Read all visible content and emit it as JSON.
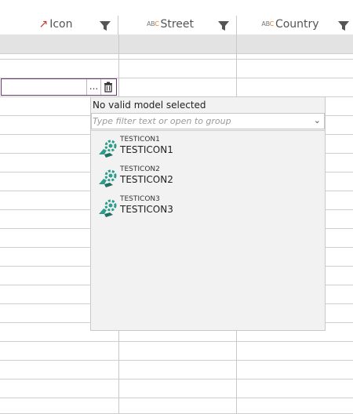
{
  "columns": [
    {
      "label": "Icon",
      "type_glyph": "↗"
    },
    {
      "label": "Street",
      "type_glyph": "ABC"
    },
    {
      "label": "Country",
      "type_glyph": "ABC"
    }
  ],
  "editor": {
    "value": "",
    "browse_glyph": "..."
  },
  "dropdown": {
    "message": "No valid model selected",
    "filter_placeholder": "Type filter text or open to group",
    "items": [
      {
        "code": "TESTICON1",
        "name": "TESTICON1"
      },
      {
        "code": "TESTICON2",
        "name": "TESTICON2"
      },
      {
        "code": "TESTICON3",
        "name": "TESTICON3"
      }
    ]
  },
  "colors": {
    "accent": "#6b3a74",
    "icon_green": "#2e9c8a"
  }
}
